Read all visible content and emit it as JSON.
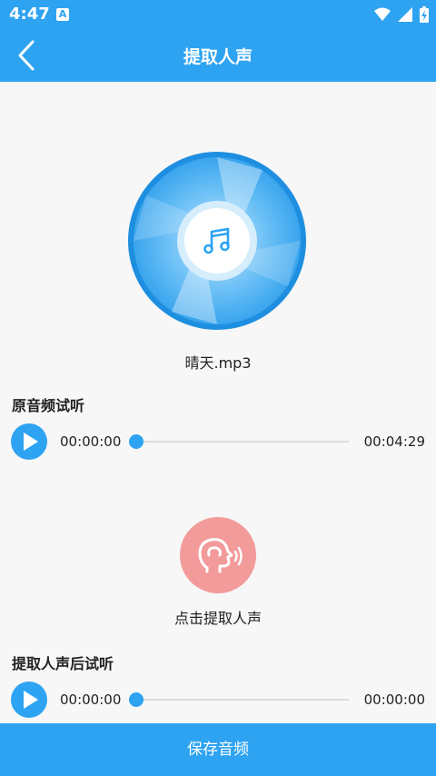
{
  "status_bar": {
    "time": "4:47",
    "app_badge": "A"
  },
  "header": {
    "title": "提取人声"
  },
  "disc": {
    "file_name": "晴天.mp3"
  },
  "original_section": {
    "title": "原音频试听",
    "current_time": "00:00:00",
    "total_time": "00:04:29",
    "progress": 0
  },
  "extract": {
    "label": "点击提取人声"
  },
  "extracted_section": {
    "title": "提取人声后试听",
    "current_time": "00:00:00",
    "total_time": "00:00:00",
    "progress": 0
  },
  "footer": {
    "save_label": "保存音频"
  },
  "colors": {
    "primary": "#2ea3f2",
    "extract_button": "#f39a9a",
    "background": "#f7f7f7"
  }
}
